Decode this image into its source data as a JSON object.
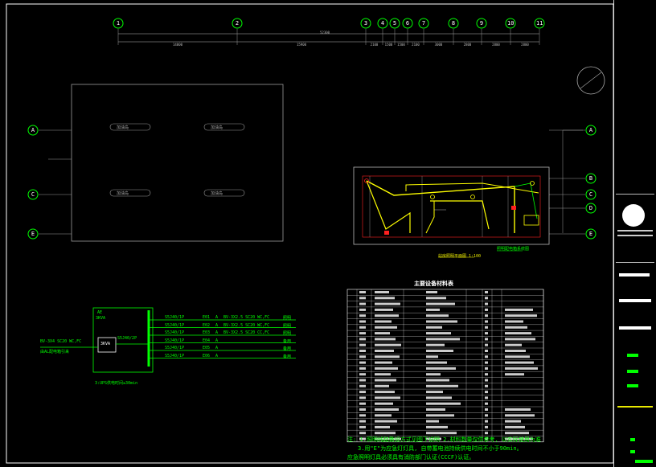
{
  "grid": {
    "top_axes": [
      "1",
      "2",
      "3",
      "4",
      "5",
      "6",
      "7",
      "8",
      "9",
      "10",
      "11"
    ],
    "top_dims": [
      "14800",
      "15900",
      "2100",
      "1500",
      "1500",
      "2100",
      "3000",
      "2800",
      "2800",
      "2800"
    ],
    "total_dim": "52300",
    "left_rows": [
      "A",
      "C",
      "E"
    ],
    "right_rows": [
      "A",
      "B",
      "C",
      "D",
      "E"
    ]
  },
  "hall_labels": [
    "加油岛",
    "加油岛",
    "加油岛",
    "加油岛"
  ],
  "plan_caption": "站房照明平面图 1:100",
  "legend_caption": "照明配电箱系统图",
  "panel": {
    "name": "AE",
    "power": "3KVA",
    "feeder": "BV-3X4 SC20 WC,FC",
    "feeder_note": "由AL配电箱引来",
    "ups": "3KVA",
    "main_breaker": "S5J40/2P",
    "ups_note": "3:UPS供电时间≥30min",
    "circuits": [
      {
        "breaker": "S5J40/1P",
        "id": "E01",
        "phase": "A",
        "cable": "BV-3X2.5 SC20 WC,FC",
        "use": "照明"
      },
      {
        "breaker": "S5J40/1P",
        "id": "E02",
        "phase": "A",
        "cable": "BV-3X2.5 SC20 WC,FC",
        "use": "照明"
      },
      {
        "breaker": "S5J40/1P",
        "id": "E03",
        "phase": "A",
        "cable": "BV-3X2.5 SC20 CC,FC",
        "use": "照明"
      },
      {
        "breaker": "S5J40/1P",
        "id": "E04",
        "phase": "A",
        "cable": "",
        "use": "备用"
      },
      {
        "breaker": "S5J40/1P",
        "id": "E05",
        "phase": "A",
        "cable": "",
        "use": "备用"
      },
      {
        "breaker": "S5J40/1P",
        "id": "E06",
        "phase": "A",
        "cable": "",
        "use": "备用"
      }
    ]
  },
  "table_title": "主要设备材料表",
  "notes": {
    "line1": "注: 1.照明线路敷设方式见图下说明 2.材料数量仅供参考, 以实际使用为准",
    "line2": "3.用\"E\"为应急灯灯具, 自带蓄电池持续供电时间不小于90min。",
    "line3": "应急照明灯具必须具有消防部门认证(CCCF)认证。"
  },
  "colors": {
    "background": "#000000",
    "accent_green": "#00ff00",
    "circuit_yellow": "#ffff00",
    "wall_red": "#ff2020",
    "line_grey": "#9a9a9a"
  }
}
